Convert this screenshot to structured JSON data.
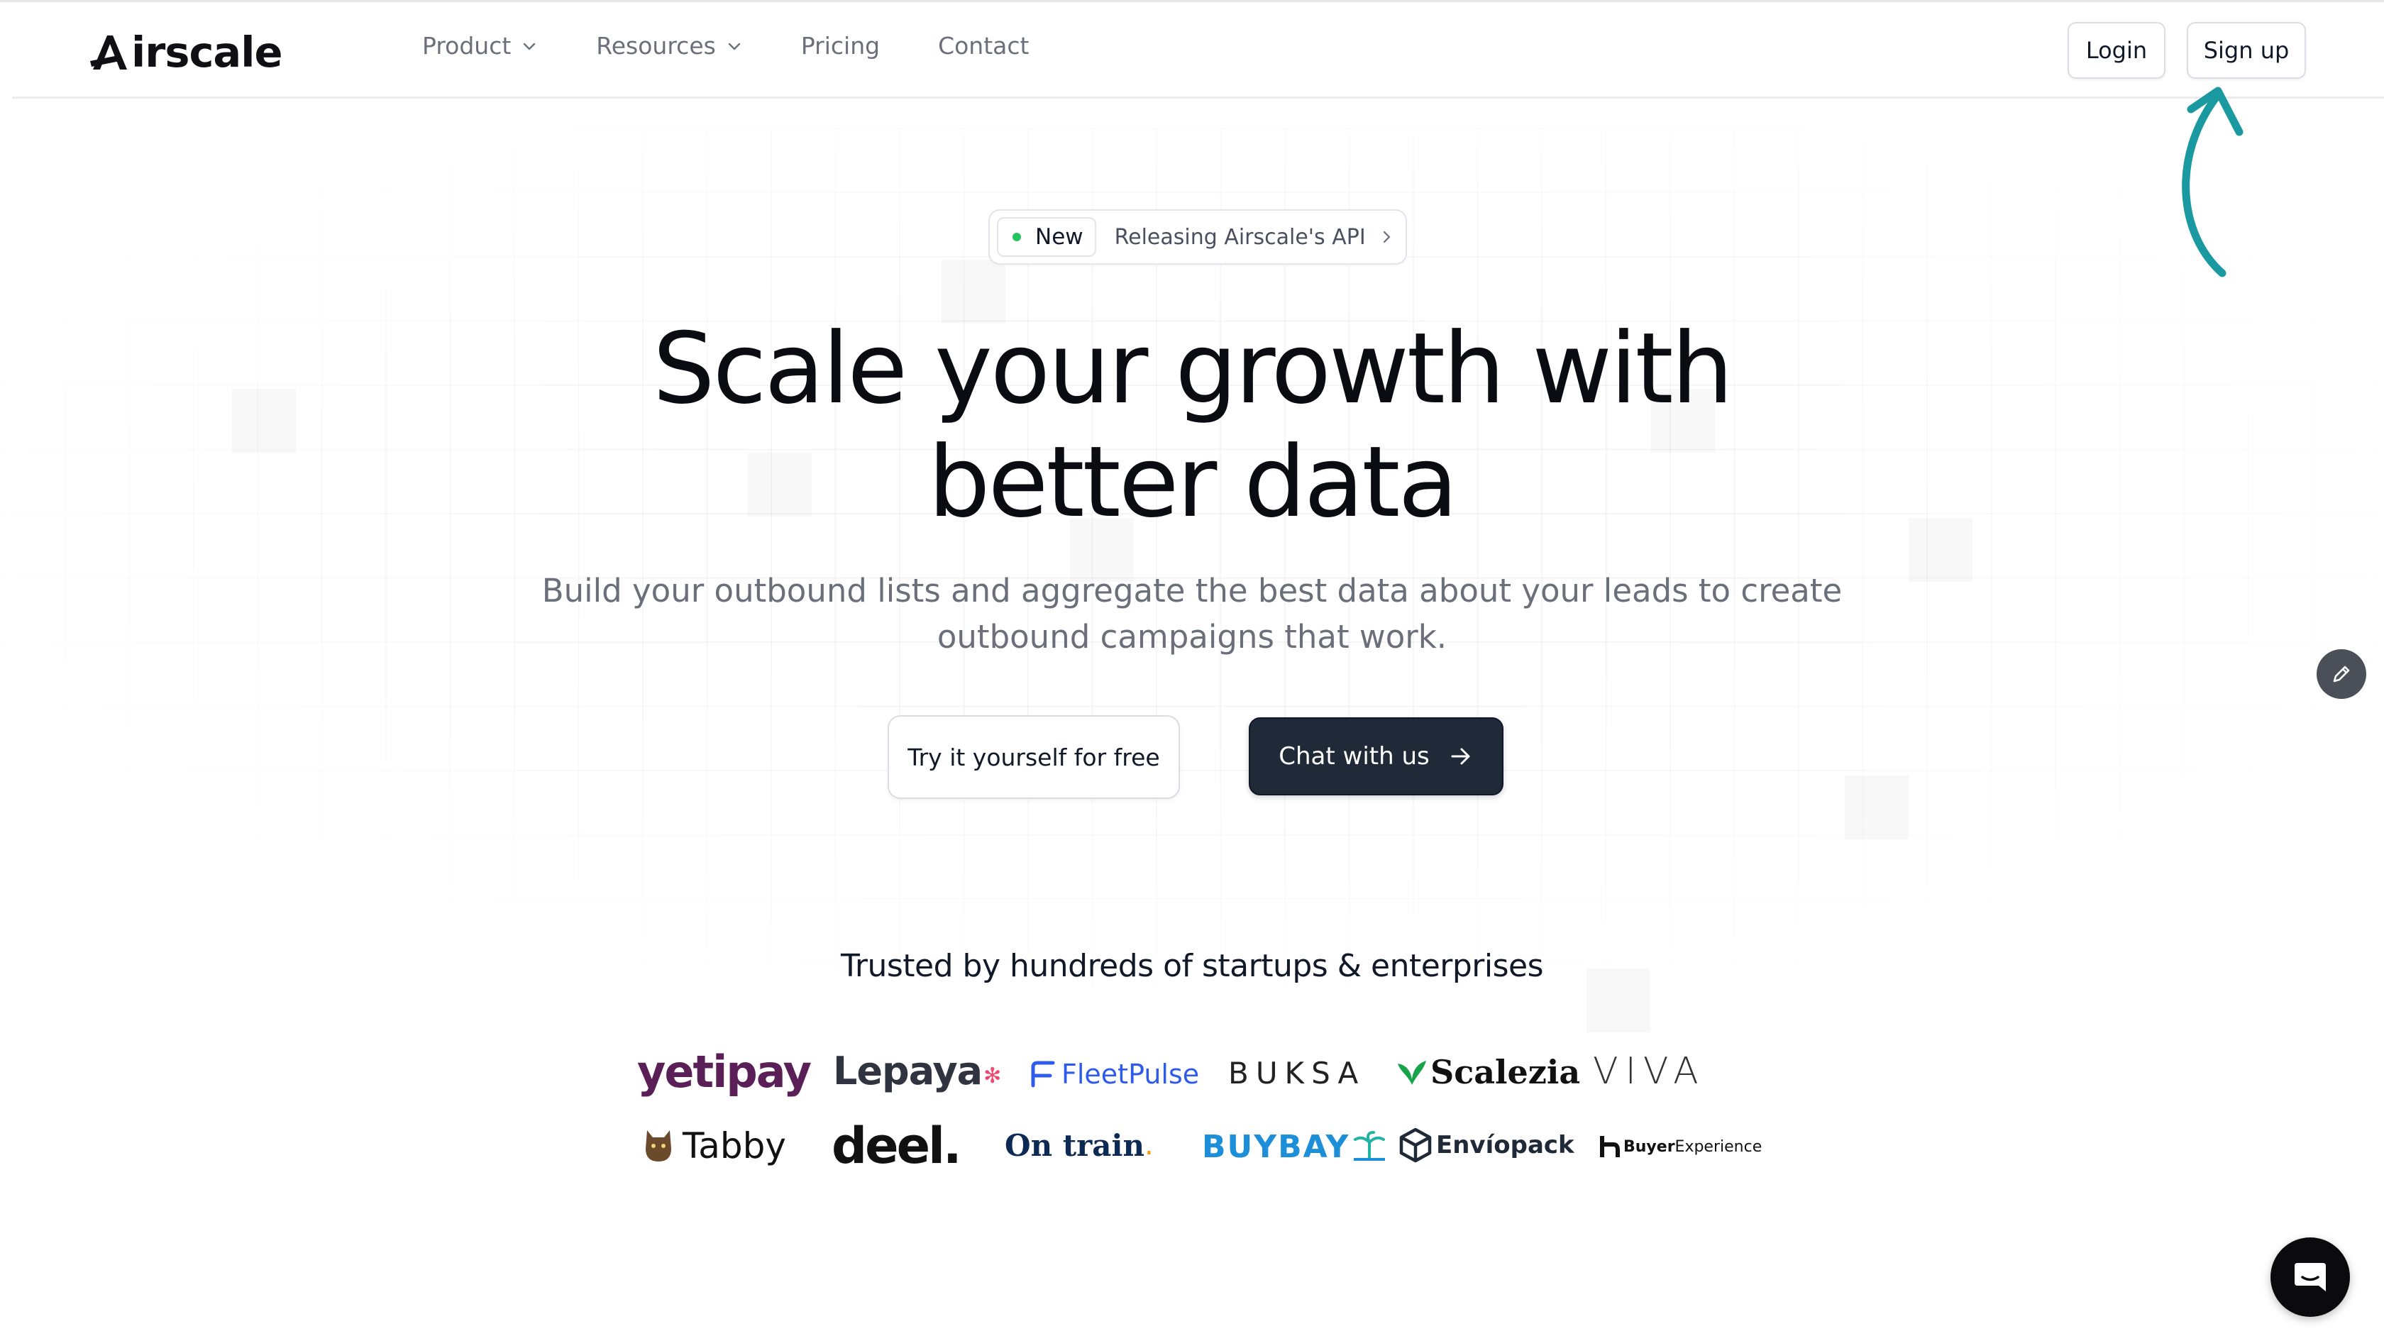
{
  "brand": {
    "name": "irscale",
    "logo_icon": "airscale-a-logo"
  },
  "nav": {
    "items": [
      {
        "label": "Product",
        "has_dropdown": true
      },
      {
        "label": "Resources",
        "has_dropdown": true
      },
      {
        "label": "Pricing",
        "has_dropdown": false
      },
      {
        "label": "Contact",
        "has_dropdown": false
      }
    ],
    "login_label": "Login",
    "signup_label": "Sign up"
  },
  "announcement": {
    "badge": "New",
    "text": "Releasing Airscale's API",
    "dot_color": "#22c55e"
  },
  "hero": {
    "title_line1": "Scale your growth with",
    "title_line2": "better data",
    "subtitle": "Build your outbound lists and aggregate the best data about your leads to create outbound campaigns that work.",
    "cta_secondary": "Try it yourself for free",
    "cta_primary": "Chat with us"
  },
  "trusted": {
    "heading": "Trusted by hundreds of startups & enterprises",
    "logos_row1": [
      "yetipay",
      "Lepaya",
      "FleetPulse",
      "BUKSA",
      "Scalezia",
      "VIVA"
    ],
    "logos_row2": [
      "Tabby",
      "deel.",
      "On train",
      "BUYBAY",
      "Envíopack",
      "Buyer",
      "Experience"
    ]
  },
  "colors": {
    "primary_button": "#1f2937",
    "annotation_arrow": "#1a9aa0",
    "yetipay": "#5b1f57",
    "lepaya_accent": "#ef476f",
    "fleetpulse": "#2f5bea",
    "ontrain": "#0d2a55",
    "buybay": "#1d8fd8"
  },
  "icons": {
    "edit": "pencil-icon",
    "chat": "chat-bubble-icon",
    "annotation": "curved-arrow-icon"
  }
}
